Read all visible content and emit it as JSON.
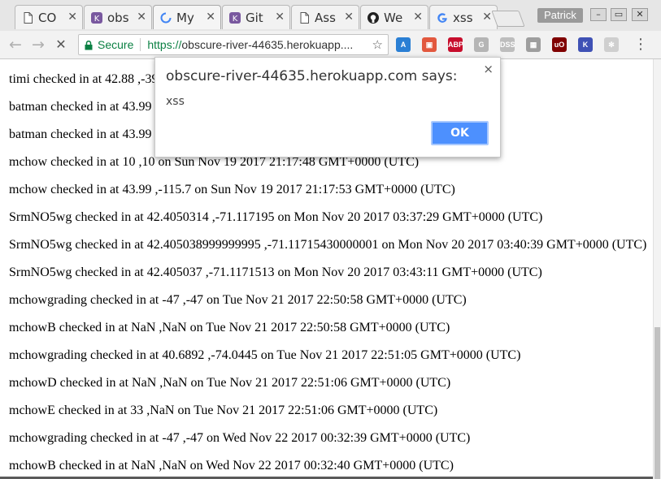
{
  "browser": {
    "tabs": [
      {
        "title": "CO",
        "favicon": "document-icon"
      },
      {
        "title": "obs",
        "favicon": "heroku-icon"
      },
      {
        "title": "My",
        "favicon": "loading-spinner-icon"
      },
      {
        "title": "Git",
        "favicon": "heroku-icon"
      },
      {
        "title": "Ass",
        "favicon": "document-icon"
      },
      {
        "title": "We",
        "favicon": "github-icon"
      },
      {
        "title": "xss",
        "favicon": "google-icon"
      }
    ],
    "profile_name": "Patrick",
    "window_controls": {
      "minimize": "–",
      "maximize": "▭",
      "close": "✕"
    }
  },
  "toolbar": {
    "back": "←",
    "forward": "→",
    "reload": "✕",
    "secure_label": "Secure",
    "url_scheme": "https://",
    "url_rest": "obscure-river-44635.herokuapp....",
    "star": "☆",
    "menu": "⋮",
    "extensions": [
      {
        "name": "a-extension-icon",
        "label": "A",
        "color": "#2a7fd4"
      },
      {
        "name": "red-extension-icon",
        "label": "▣",
        "color": "#e2583e"
      },
      {
        "name": "adblock-plus-icon",
        "label": "ABP",
        "color": "#c70d2c"
      },
      {
        "name": "g-extension-icon",
        "label": "G",
        "color": "#b5b5b5"
      },
      {
        "name": "dss-extension-icon",
        "label": "DSS",
        "color": "#bdbdbd"
      },
      {
        "name": "image-extension-icon",
        "label": "▦",
        "color": "#9e9e9e"
      },
      {
        "name": "ublock-origin-icon",
        "label": "uO",
        "color": "#800000"
      },
      {
        "name": "k-extension-icon",
        "label": "K",
        "color": "#3f51b5"
      },
      {
        "name": "gear-extension-icon",
        "label": "✻",
        "color": "#cfcfcf"
      }
    ]
  },
  "page": {
    "lines": [
      "timi checked in at 42.88 ,-39",
      "batman checked in at 43.99",
      "batman checked in at 43.99",
      "mchow checked in at 10 ,10 on Sun Nov 19 2017 21:17:48 GMT+0000 (UTC)",
      "mchow checked in at 43.99 ,-115.7 on Sun Nov 19 2017 21:17:53 GMT+0000 (UTC)",
      "SrmNO5wg checked in at 42.4050314 ,-71.117195 on Mon Nov 20 2017 03:37:29 GMT+0000 (UTC)",
      "SrmNO5wg checked in at 42.405038999999995 ,-71.11715430000001 on Mon Nov 20 2017 03:40:39 GMT+0000 (UTC)",
      "SrmNO5wg checked in at 42.405037 ,-71.1171513 on Mon Nov 20 2017 03:43:11 GMT+0000 (UTC)",
      "mchowgrading checked in at -47 ,-47 on Tue Nov 21 2017 22:50:58 GMT+0000 (UTC)",
      "mchowB checked in at NaN ,NaN on Tue Nov 21 2017 22:50:58 GMT+0000 (UTC)",
      "mchowgrading checked in at 40.6892 ,-74.0445 on Tue Nov 21 2017 22:51:05 GMT+0000 (UTC)",
      "mchowD checked in at NaN ,NaN on Tue Nov 21 2017 22:51:06 GMT+0000 (UTC)",
      "mchowE checked in at 33 ,NaN on Tue Nov 21 2017 22:51:06 GMT+0000 (UTC)",
      "mchowgrading checked in at -47 ,-47 on Wed Nov 22 2017 00:32:39 GMT+0000 (UTC)",
      "mchowB checked in at NaN ,NaN on Wed Nov 22 2017 00:32:40 GMT+0000 (UTC)"
    ]
  },
  "dialog": {
    "title": "obscure-river-44635.herokuapp.com says:",
    "message": "xss",
    "ok_label": "OK",
    "close": "×"
  }
}
